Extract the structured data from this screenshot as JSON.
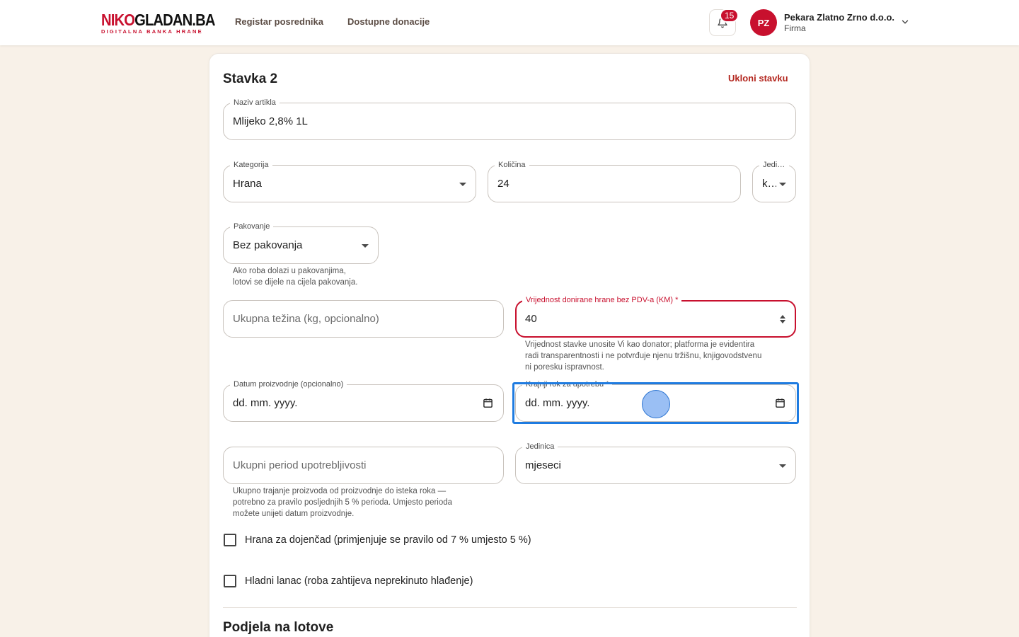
{
  "header": {
    "logo_part1": "NIKO",
    "logo_part2": "GLADAN.BA",
    "logo_tagline": "DIGITALNA BANKA HRANE",
    "nav": [
      "Registar posrednika",
      "Dostupne donacije"
    ],
    "notifications_count": "15",
    "user_initials": "PZ",
    "user_name": "Pekara Zlatno Zrno d.o.o.",
    "user_role": "Firma"
  },
  "form": {
    "item_title": "Stavka 2",
    "remove_label": "Ukloni stavku",
    "article_name": {
      "label": "Naziv artikla",
      "value": "Mlijeko 2,8% 1L"
    },
    "category": {
      "label": "Kategorija",
      "value": "Hrana"
    },
    "quantity": {
      "label": "Količina",
      "value": "24"
    },
    "unit": {
      "label": "Jedinica",
      "value": "kom"
    },
    "packaging": {
      "label": "Pakovanje",
      "value": "Bez pakovanja",
      "helper": [
        "Ako roba dolazi u pakovanjima,",
        "lotovi se dijele na cijela pakovanja."
      ]
    },
    "total_weight": {
      "placeholder": "Ukupna težina (kg, opcionalno)"
    },
    "donated_value": {
      "label": "Vrijednost donirane hrane bez PDV-a (KM) *",
      "value": "40",
      "helper": [
        "Vrijednost stavke unosite Vi kao donator; platforma je evidentira",
        "radi transparentnosti i ne potvrđuje njenu tržišnu, knjigovodstvenu",
        "ni poresku ispravnost."
      ]
    },
    "production_date": {
      "label": "Datum proizvodnje (opcionalno)",
      "value": "dd. mm. yyyy."
    },
    "expiry_date": {
      "label": "Krajnji rok za upotrebu *",
      "value": "dd. mm. yyyy."
    },
    "shelf_life": {
      "placeholder": "Ukupni period upotrebljivosti",
      "helper": [
        "Ukupno trajanje proizvoda od proizvodnje do isteka roka —",
        "potrebno za pravilo posljednjih 5 % perioda. Umjesto perioda",
        "možete unijeti datum proizvodnje."
      ]
    },
    "shelf_unit": {
      "label": "Jedinica",
      "value": "mjeseci"
    },
    "infant_food": "Hrana za dojenčad (primjenjuje se pravilo od 7 % umjesto 5 %)",
    "cold_chain": "Hladni lanac (roba zahtijeva neprekinuto hlađenje)",
    "lots_title": "Podjela na lotove"
  },
  "colors": {
    "brand_red": "#c8102e",
    "focus_blue": "#1e7be0",
    "page_bg": "#f8f1e8"
  }
}
